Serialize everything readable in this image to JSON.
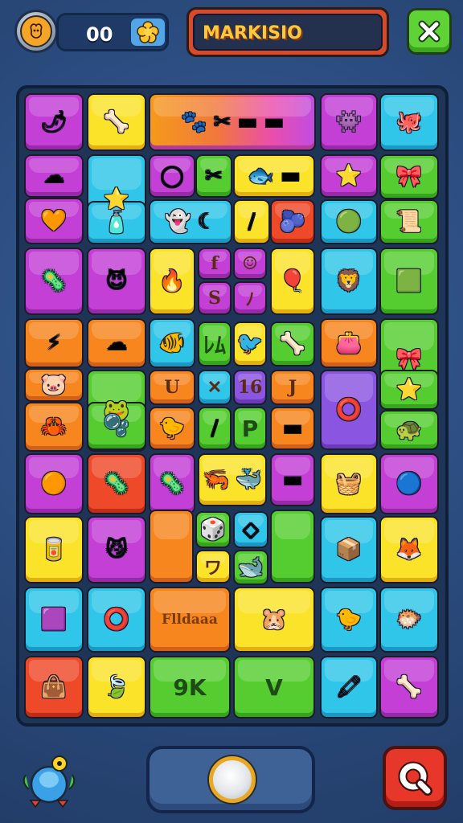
{
  "hud": {
    "score": "00",
    "coin_icon": "paw-icon",
    "score_badge_icon": "flower-icon",
    "title": "MARKISIO",
    "close_icon": "close-icon"
  },
  "board": {
    "tiles": [
      {
        "color": "pink",
        "glyph": "🌶"
      },
      {
        "color": "yellow",
        "glyph": "🦴"
      },
      {
        "color": "grad",
        "glyph": "🐾 ✂ ▬ ▬"
      },
      {
        "color": "pink",
        "glyph": "👾"
      },
      {
        "color": "cyan",
        "glyph": "🐙"
      },
      {
        "color": "pink",
        "glyph": "☁"
      },
      {
        "color": "pink",
        "glyph": "🧡"
      },
      {
        "color": "cyan",
        "glyph": "⭐"
      },
      {
        "color": "cyan",
        "glyph": "🧴"
      },
      {
        "color": "pink",
        "glyph": "◯"
      },
      {
        "color": "green",
        "glyph": "✂"
      },
      {
        "color": "yellow",
        "glyph": "🐟 ▬"
      },
      {
        "color": "cyan",
        "glyph": "👻 ☾"
      },
      {
        "color": "yellow",
        "glyph": "/"
      },
      {
        "color": "red",
        "glyph": "🫐"
      },
      {
        "color": "pink",
        "glyph": "⭐"
      },
      {
        "color": "cyan",
        "glyph": "🟢"
      },
      {
        "color": "green",
        "glyph": "🎀"
      },
      {
        "color": "green",
        "glyph": "📜"
      },
      {
        "color": "pink",
        "glyph": "🦠"
      },
      {
        "color": "pink",
        "glyph": "😈"
      },
      {
        "color": "yellow",
        "glyph": "🔥"
      },
      {
        "color": "pink",
        "text": "f"
      },
      {
        "color": "pink",
        "text": "☺"
      },
      {
        "color": "pink",
        "text": "S"
      },
      {
        "color": "pink",
        "text": "ﾉ"
      },
      {
        "color": "yellow",
        "glyph": "🎈"
      },
      {
        "color": "cyan",
        "glyph": "🦁"
      },
      {
        "color": "green",
        "glyph": "🟩"
      },
      {
        "color": "orange",
        "glyph": "⚡"
      },
      {
        "color": "orange",
        "glyph": "☁"
      },
      {
        "color": "orange",
        "glyph": "🦀"
      },
      {
        "color": "orange",
        "glyph": "🐷"
      },
      {
        "color": "green",
        "glyph": "🐸"
      },
      {
        "color": "green",
        "glyph": "🫧"
      },
      {
        "color": "cyan",
        "glyph": "🐠"
      },
      {
        "color": "green",
        "text": "ﾚﾑ"
      },
      {
        "color": "yellow",
        "glyph": "🐦"
      },
      {
        "color": "green",
        "glyph": "🦴"
      },
      {
        "color": "orange",
        "text": "U"
      },
      {
        "color": "cyan",
        "text": "✕"
      },
      {
        "color": "purple",
        "text": "16"
      },
      {
        "color": "orange",
        "text": "J"
      },
      {
        "color": "orange",
        "glyph": "🐤"
      },
      {
        "color": "green",
        "glyph": "/"
      },
      {
        "color": "green",
        "text": "P"
      },
      {
        "color": "orange",
        "glyph": "▬"
      },
      {
        "color": "orange",
        "glyph": "👛"
      },
      {
        "color": "purple",
        "glyph": "⭕"
      },
      {
        "color": "green",
        "glyph": "🎀"
      },
      {
        "color": "green",
        "glyph": "⭐"
      },
      {
        "color": "green",
        "glyph": "🐢"
      },
      {
        "color": "pink",
        "glyph": "🟠"
      },
      {
        "color": "red",
        "glyph": "🦠"
      },
      {
        "color": "pink",
        "glyph": "🦠"
      },
      {
        "color": "yellow",
        "glyph": "🦐 🐳"
      },
      {
        "color": "pink",
        "glyph": "▬"
      },
      {
        "color": "yellow",
        "glyph": "🧺"
      },
      {
        "color": "pink",
        "glyph": "🔵"
      },
      {
        "color": "yellow",
        "glyph": "🥫"
      },
      {
        "color": "pink",
        "glyph": "😼"
      },
      {
        "color": "orange",
        "glyph": ""
      },
      {
        "color": "green",
        "glyph": "🎲"
      },
      {
        "color": "cyan",
        "glyph": "◇"
      },
      {
        "color": "yellow",
        "text": "ワ"
      },
      {
        "color": "green",
        "glyph": "🐋"
      },
      {
        "color": "green",
        "glyph": ""
      },
      {
        "color": "cyan",
        "glyph": "📦"
      },
      {
        "color": "yellow",
        "glyph": "🦊"
      },
      {
        "color": "cyan",
        "glyph": "🟪"
      },
      {
        "color": "cyan",
        "glyph": "⭕"
      },
      {
        "color": "orange",
        "text": "Flldaaa"
      },
      {
        "color": "yellow",
        "glyph": "🐹"
      },
      {
        "color": "cyan",
        "glyph": "🐤"
      },
      {
        "color": "cyan",
        "glyph": "🐡"
      },
      {
        "color": "red",
        "glyph": "👜"
      },
      {
        "color": "yellow",
        "glyph": "🍃"
      },
      {
        "color": "green",
        "text": "9K"
      },
      {
        "color": "green",
        "text": "V"
      },
      {
        "color": "cyan",
        "glyph": "🖍"
      },
      {
        "color": "pink",
        "glyph": "🦴"
      }
    ]
  },
  "bottom": {
    "mascot_icon": "bird-mascot-icon",
    "center_button_icon": "pearl-icon",
    "search_icon": "search-icon"
  }
}
